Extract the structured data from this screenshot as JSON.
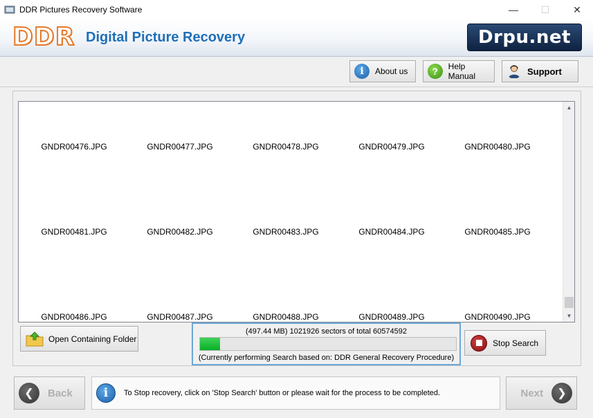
{
  "window": {
    "title": "DDR Pictures Recovery Software",
    "controls": [
      "minimize",
      "maximize",
      "close"
    ]
  },
  "banner": {
    "logo_text": "DDR",
    "app_name": "Digital Picture Recovery",
    "brand": "Drpu.net"
  },
  "toolbar": {
    "about": "About us",
    "help": "Help Manual",
    "support": "Support"
  },
  "gallery": {
    "items": [
      {
        "name": "GNDR00476.JPG",
        "colors": [
          "#7fa7c2",
          "#3b3a36",
          "#c9b896"
        ]
      },
      {
        "name": "GNDR00477.JPG",
        "colors": [
          "#b44a3a",
          "#2a2222",
          "#d8c0a8"
        ]
      },
      {
        "name": "GNDR00478.JPG",
        "colors": [
          "#d76b7a",
          "#6e8e3c",
          "#f0d1b0"
        ]
      },
      {
        "name": "GNDR00479.JPG",
        "colors": [
          "#d43a3a",
          "#e8c440",
          "#2b2b2b"
        ]
      },
      {
        "name": "GNDR00480.JPG",
        "colors": [
          "#3f7d3f",
          "#285c28",
          "#c9b08f"
        ]
      },
      {
        "name": "GNDR00481.JPG",
        "colors": [
          "#3aa0d8",
          "#e26a2c",
          "#f3e0c8"
        ]
      },
      {
        "name": "GNDR00482.JPG",
        "colors": [
          "#8aa0a8",
          "#2f4a30",
          "#c83c3c"
        ]
      },
      {
        "name": "GNDR00483.JPG",
        "colors": [
          "#b0b4b8",
          "#2a2f54",
          "#5a7fb8"
        ]
      },
      {
        "name": "GNDR00484.JPG",
        "colors": [
          "#3c4a2a",
          "#e8b820",
          "#7a5a3a"
        ]
      },
      {
        "name": "GNDR00485.JPG",
        "colors": [
          "#3a5a2a",
          "#a05030",
          "#6a7a4a"
        ]
      },
      {
        "name": "GNDR00486.JPG",
        "colors": [
          "#8aa860",
          "#e8e8e8",
          "#3a4a2a"
        ]
      },
      {
        "name": "GNDR00487.JPG",
        "colors": [
          "#4a3a2a",
          "#c89a6a",
          "#e8d8c8"
        ]
      },
      {
        "name": "GNDR00488.JPG",
        "colors": [
          "#8ab0c8",
          "#3a3a3a",
          "#d8b898"
        ]
      },
      {
        "name": "GNDR00489.JPG",
        "colors": [
          "#2a3a3a",
          "#6a9a9a",
          "#c8c8c8"
        ]
      },
      {
        "name": "GNDR00490.JPG",
        "colors": [
          "#b8a898",
          "#2a2a2a",
          "#8a3a3a"
        ]
      }
    ]
  },
  "actions": {
    "open_folder": "Open Containing Folder",
    "stop_search": "Stop Search"
  },
  "progress": {
    "summary": "(497.44 MB) 1021926  sectors  of  total 60574592",
    "fraction": 0.0787,
    "status": "(Currently performing Search based on:  DDR General Recovery Procedure)"
  },
  "footer": {
    "back": "Back",
    "next": "Next",
    "info": "To Stop recovery, click on 'Stop Search' button or please wait for the process to be completed."
  }
}
